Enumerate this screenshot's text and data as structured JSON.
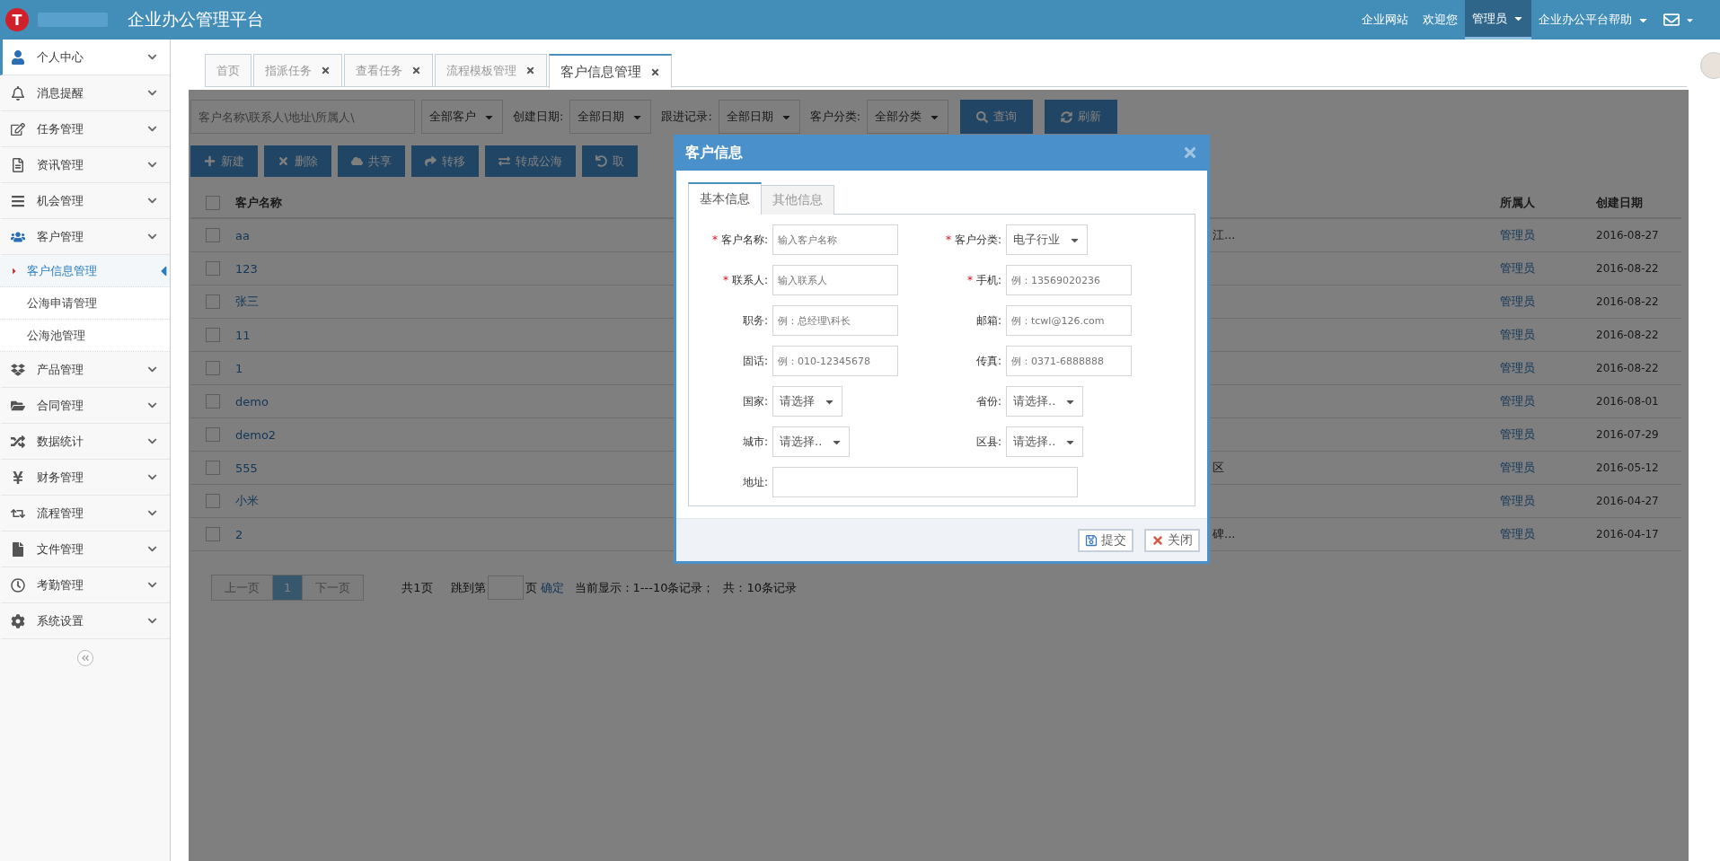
{
  "header": {
    "logo_letter": "T",
    "title": "企业办公管理平台",
    "links": [
      {
        "text": "企业网站",
        "selected": false,
        "caret": false
      },
      {
        "text": "欢迎您",
        "selected": false,
        "caret": false
      },
      {
        "text": "管理员",
        "selected": true,
        "caret": true
      },
      {
        "text": "企业办公平台帮助",
        "selected": false,
        "caret": true
      }
    ]
  },
  "sidebar": {
    "items": [
      {
        "label": "个人中心",
        "selected": true,
        "expanded": false
      },
      {
        "label": "消息提醒",
        "selected": false,
        "expanded": false
      },
      {
        "label": "任务管理",
        "selected": false,
        "expanded": false
      },
      {
        "label": "资讯管理",
        "selected": false,
        "expanded": false
      },
      {
        "label": "机会管理",
        "selected": false,
        "expanded": false
      },
      {
        "label": "客户管理",
        "selected": false,
        "expanded": true,
        "children": [
          {
            "label": "客户信息管理",
            "selected": true
          },
          {
            "label": "公海申请管理",
            "selected": false
          },
          {
            "label": "公海池管理",
            "selected": false
          }
        ]
      },
      {
        "label": "产品管理",
        "selected": false,
        "expanded": false
      },
      {
        "label": "合同管理",
        "selected": false,
        "expanded": false
      },
      {
        "label": "数据统计",
        "selected": false,
        "expanded": false
      },
      {
        "label": "财务管理",
        "selected": false,
        "expanded": false
      },
      {
        "label": "流程管理",
        "selected": false,
        "expanded": false
      },
      {
        "label": "文件管理",
        "selected": false,
        "expanded": false
      },
      {
        "label": "考勤管理",
        "selected": false,
        "expanded": false
      },
      {
        "label": "系统设置",
        "selected": false,
        "expanded": false
      }
    ]
  },
  "tabs": [
    {
      "label": "首页",
      "selected": false,
      "closable": false
    },
    {
      "label": "指派任务",
      "selected": false,
      "closable": true
    },
    {
      "label": "查看任务",
      "selected": false,
      "closable": true
    },
    {
      "label": "流程模板管理",
      "selected": false,
      "closable": true
    },
    {
      "label": "客户信息管理",
      "selected": true,
      "closable": true
    }
  ],
  "filters": [
    {
      "kind": "search",
      "placeholder": "客户名称\\联系人\\地址\\所属人\\"
    },
    {
      "kind": "select",
      "value": "全部客户"
    },
    {
      "kind": "select",
      "label": "创建日期:",
      "value": "全部日期"
    },
    {
      "kind": "select",
      "label": "跟进记录:",
      "value": "全部日期"
    },
    {
      "kind": "select",
      "label": "客户分类:",
      "value": "全部分类"
    },
    {
      "kind": "button",
      "text": "查询"
    },
    {
      "kind": "button",
      "text": "刷新"
    }
  ],
  "toolbar": [
    "新建",
    "删除",
    "共享",
    "转移",
    "转成公海",
    "取"
  ],
  "table": {
    "header_checked": false,
    "columns": [
      "客户名称",
      "所属人",
      "创建日期"
    ],
    "rows": [
      {
        "checked": false,
        "name": "aa",
        "column_3": "江...",
        "owner": "管理员",
        "date": "2016-08-27"
      },
      {
        "checked": false,
        "name": "123",
        "owner": "管理员",
        "date": "2016-08-22"
      },
      {
        "checked": false,
        "name": "张三",
        "owner": "管理员",
        "date": "2016-08-22"
      },
      {
        "checked": false,
        "name": "11",
        "owner": "管理员",
        "date": "2016-08-22"
      },
      {
        "checked": false,
        "name": "1",
        "owner": "管理员",
        "date": "2016-08-22"
      },
      {
        "checked": false,
        "name": "demo",
        "owner": "管理员",
        "date": "2016-08-01"
      },
      {
        "checked": false,
        "name": "demo2",
        "owner": "管理员",
        "date": "2016-07-29"
      },
      {
        "checked": false,
        "name": "555",
        "column_3": "区",
        "owner": "管理员",
        "date": "2016-05-12"
      },
      {
        "checked": false,
        "name": "小米",
        "owner": "管理员",
        "date": "2016-04-27"
      },
      {
        "checked": false,
        "name": "2",
        "column_3": "碑...",
        "owner": "管理员",
        "date": "2016-04-17"
      }
    ]
  },
  "pagination": {
    "pages": [
      {
        "label": "上一页",
        "kind": "nav",
        "selected": false
      },
      {
        "label": "1",
        "kind": "page",
        "selected": true
      },
      {
        "label": "下一页",
        "kind": "nav",
        "selected": false
      }
    ],
    "total_pages": "共1页",
    "jump_label": "跳到第",
    "jump_suffix": "页",
    "confirm": "确定",
    "showing": "当前显示：1---10条记录；",
    "total": "共：10条记录"
  },
  "modal": {
    "title": "客户信息",
    "tabs": [
      {
        "label": "基本信息",
        "selected": true
      },
      {
        "label": "其他信息",
        "selected": false
      }
    ],
    "fields": [
      {
        "label": "客户名称:",
        "required_mark": "*",
        "kind": "text",
        "placeholder": "输入客户名称"
      },
      {
        "label": "客户分类:",
        "required_mark": "*",
        "kind": "select",
        "value": "电子行业"
      },
      {
        "label": "联系人:",
        "required_mark": "*",
        "kind": "text",
        "placeholder": "输入联系人"
      },
      {
        "label": "手机:",
        "required_mark": "*",
        "kind": "text",
        "placeholder": "例：13569020236"
      },
      {
        "label": "职务:",
        "kind": "text",
        "placeholder": "例：总经理\\科长"
      },
      {
        "label": "邮箱:",
        "kind": "text",
        "placeholder": "例：tcwl@126.com"
      },
      {
        "label": "固话:",
        "kind": "text",
        "placeholder": "例：010-12345678"
      },
      {
        "label": "传真:",
        "kind": "text",
        "placeholder": "例：0371-6888888"
      },
      {
        "label": "国家:",
        "kind": "select",
        "value": "请选择"
      },
      {
        "label": "省份:",
        "kind": "select",
        "value": "请选择.."
      },
      {
        "label": "城市:",
        "kind": "select",
        "value": "请选择.."
      },
      {
        "label": "区县:",
        "kind": "select",
        "value": "请选择.."
      },
      {
        "label": "地址:",
        "kind": "wide"
      }
    ],
    "buttons": [
      {
        "text": "提交",
        "kind": "save"
      },
      {
        "text": "关闭",
        "kind": "close"
      }
    ]
  }
}
